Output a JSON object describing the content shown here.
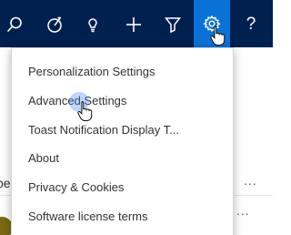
{
  "navbar": {
    "icons": [
      "search-icon",
      "compass-icon",
      "lightbulb-icon",
      "plus-icon",
      "filter-icon",
      "gear-icon",
      "help-icon"
    ],
    "help_label": "?",
    "active": "gear-icon",
    "colors": {
      "bar": "#002050",
      "active": "#0a72d6",
      "icon": "#ffffff"
    }
  },
  "settings_menu": {
    "items": [
      "Personalization Settings",
      "Advanced Settings",
      "Toast Notification Display T...",
      "About",
      "Privacy & Cookies",
      "Software license terms"
    ],
    "hovered": "Advanced Settings"
  },
  "background": {
    "row_partial_text": "pe",
    "more_label": "..."
  }
}
